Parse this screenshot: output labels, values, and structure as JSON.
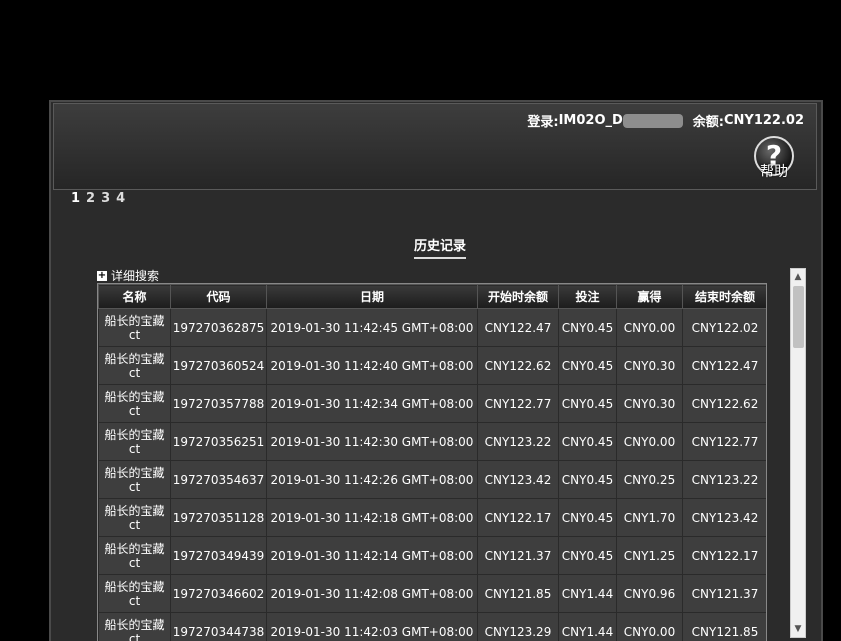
{
  "header": {
    "login_label": "登录:",
    "user_prefix": "IM02O_D",
    "balance_label": "余额:",
    "balance": "CNY122.02",
    "help_label": "帮助"
  },
  "pager": [
    "1",
    "2",
    "3",
    "4"
  ],
  "section_title": "历史记录",
  "detail_search": "详细搜索",
  "table": {
    "columns": [
      "名称",
      "代码",
      "日期",
      "开始时余额",
      "投注",
      "赢得",
      "结束时余额"
    ],
    "rows": [
      [
        "船长的宝藏ct",
        "197270362875",
        "2019-01-30 11:42:45 GMT+08:00",
        "CNY122.47",
        "CNY0.45",
        "CNY0.00",
        "CNY122.02"
      ],
      [
        "船长的宝藏ct",
        "197270360524",
        "2019-01-30 11:42:40 GMT+08:00",
        "CNY122.62",
        "CNY0.45",
        "CNY0.30",
        "CNY122.47"
      ],
      [
        "船长的宝藏ct",
        "197270357788",
        "2019-01-30 11:42:34 GMT+08:00",
        "CNY122.77",
        "CNY0.45",
        "CNY0.30",
        "CNY122.62"
      ],
      [
        "船长的宝藏ct",
        "197270356251",
        "2019-01-30 11:42:30 GMT+08:00",
        "CNY123.22",
        "CNY0.45",
        "CNY0.00",
        "CNY122.77"
      ],
      [
        "船长的宝藏ct",
        "197270354637",
        "2019-01-30 11:42:26 GMT+08:00",
        "CNY123.42",
        "CNY0.45",
        "CNY0.25",
        "CNY123.22"
      ],
      [
        "船长的宝藏ct",
        "197270351128",
        "2019-01-30 11:42:18 GMT+08:00",
        "CNY122.17",
        "CNY0.45",
        "CNY1.70",
        "CNY123.42"
      ],
      [
        "船长的宝藏ct",
        "197270349439",
        "2019-01-30 11:42:14 GMT+08:00",
        "CNY121.37",
        "CNY0.45",
        "CNY1.25",
        "CNY122.17"
      ],
      [
        "船长的宝藏ct",
        "197270346602",
        "2019-01-30 11:42:08 GMT+08:00",
        "CNY121.85",
        "CNY1.44",
        "CNY0.96",
        "CNY121.37"
      ],
      [
        "船长的宝藏ct",
        "197270344738",
        "2019-01-30 11:42:03 GMT+08:00",
        "CNY123.29",
        "CNY1.44",
        "CNY0.00",
        "CNY121.85"
      ]
    ]
  }
}
